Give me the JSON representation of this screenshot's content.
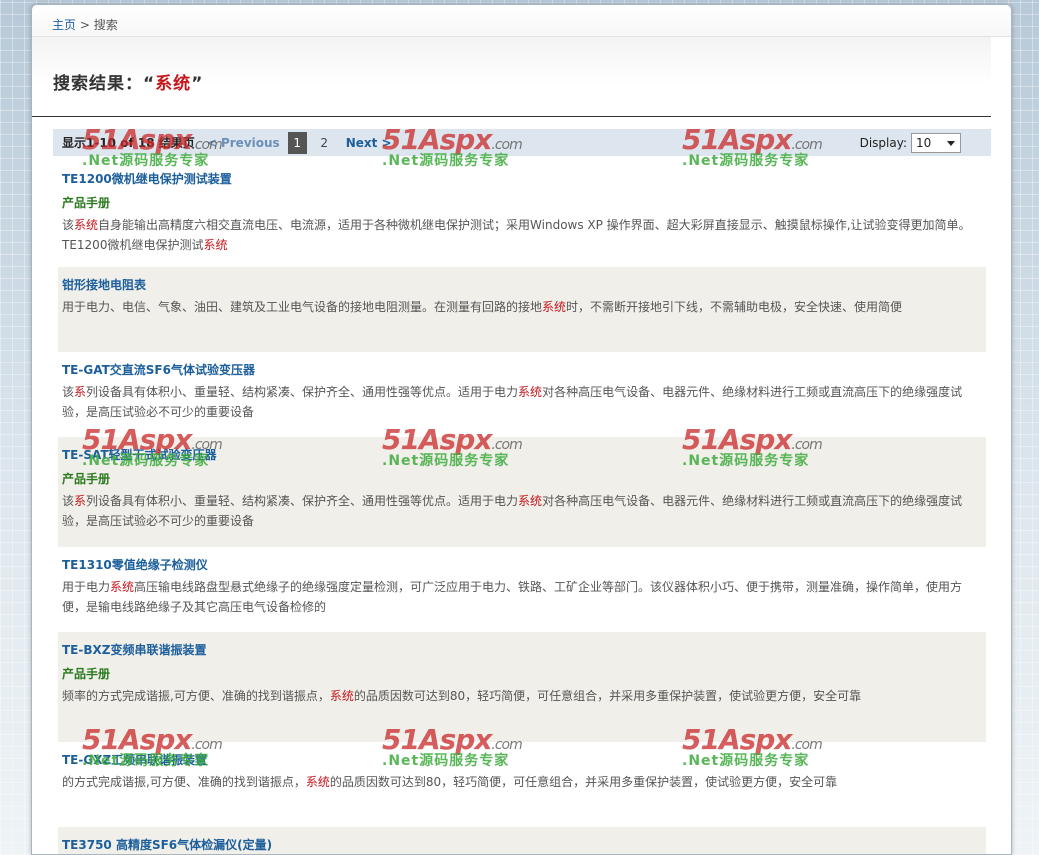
{
  "breadcrumb": {
    "home": "主页",
    "sep": ">",
    "current": "搜索"
  },
  "heading": {
    "prefix": "搜索结果：",
    "open_quote": "“",
    "keyword": "系统",
    "close_quote": "”"
  },
  "pager": {
    "count_text": "显示1-10 of 18 结果页",
    "prev": "< Previous",
    "pages": [
      "1",
      "2"
    ],
    "current_page": "1",
    "next": "Next >",
    "display_label": "Display:",
    "display_value": "10"
  },
  "results": [
    {
      "title": "TE1200微机继电保护测试装置",
      "subtitle": "产品手册",
      "lines": [
        [
          "该",
          {
            "hl": "系统"
          },
          "自身能输出高精度六相交直流电压、电流源，适用于各种微机继电保护测试；采用Windows XP 操作界面、超大彩屏直接显示、触摸鼠标操作,让试验变得更加简单。"
        ],
        [
          "TE1200微机继电保护测试",
          {
            "hl": "系统"
          }
        ]
      ]
    },
    {
      "title": "钳形接地电阻表",
      "subtitle": "",
      "lines": [
        [
          "用于电力、电信、气象、油田、建筑及工业电气设备的接地电阻测量。在测量有回路的接地",
          {
            "hl": "系统"
          },
          "时，不需断开接地引下线，不需辅助电极，安全快速、使用简便"
        ]
      ]
    },
    {
      "title": "TE-GAT交直流SF6气体试验变压器",
      "subtitle": "",
      "lines": [
        [
          "该",
          {
            "hl": "系"
          },
          "列设备具有体积小、重量轻、结构紧凑、保护齐全、通用性强等优点。适用于电力",
          {
            "hl": "系统"
          },
          "对各种高压电气设备、电器元件、绝缘材料进行工频或直流高压下的绝缘强度试"
        ],
        [
          "验，是高压试验必不可少的重要设备"
        ]
      ]
    },
    {
      "title": "TE-SAT轻型干式试验变压器",
      "subtitle": "产品手册",
      "lines": [
        [
          "该",
          {
            "hl": "系"
          },
          "列设备具有体积小、重量轻、结构紧凑、保护齐全、通用性强等优点。适用于电力",
          {
            "hl": "系统"
          },
          "对各种高压电气设备、电器元件、绝缘材料进行工频或直流高压下的绝缘强度试"
        ],
        [
          "验，是高压试验必不可少的重要设备"
        ]
      ]
    },
    {
      "title": "TE1310零值绝缘子检测仪",
      "subtitle": "",
      "lines": [
        [
          "用于电力",
          {
            "hl": "系统"
          },
          "高压输电线路盘型悬式绝缘子的绝缘强度定量检测，可广泛应用于电力、铁路、工矿企业等部门。该仪器体积小巧、便于携带，测量准确，操作简单，使用方"
        ],
        [
          "便，是输电线路绝缘子及其它高压电气设备检修的"
        ]
      ]
    },
    {
      "title": "TE-BXZ变频串联谐振装置",
      "subtitle": "产品手册",
      "lines": [
        [
          "频率的方式完成谐振,可方便、准确的找到谐振点，",
          {
            "hl": "系统"
          },
          "的品质因数可达到80，轻巧简便，可任意组合，并采用多重保护装置，使试验更方便，安全可靠"
        ]
      ]
    },
    {
      "title": "TE-GXZ工频串联谐振装置",
      "subtitle": "",
      "lines": [
        [
          "的方式完成谐振,可方便、准确的找到谐振点，",
          {
            "hl": "系统"
          },
          "的品质因数可达到80，轻巧简便，可任意组合，并采用多重保护装置，使试验更方便，安全可靠"
        ]
      ]
    },
    {
      "title": "TE3750 高精度SF6气体检漏仪(定量)",
      "subtitle": "",
      "lines": []
    }
  ],
  "watermark": {
    "logo": "51Aspx",
    "domain": ".com",
    "slogan": ".Net源码服务专家"
  }
}
